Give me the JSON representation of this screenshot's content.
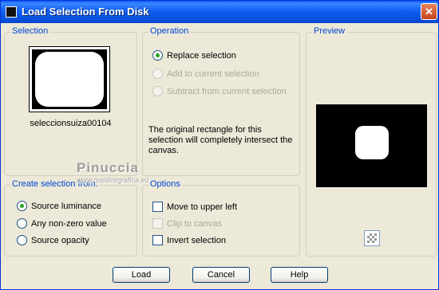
{
  "window": {
    "title": "Load Selection From Disk",
    "close_label": "✕"
  },
  "selection_group": {
    "legend": "Selection",
    "file_name": "seleccionsuiza00104"
  },
  "operation_group": {
    "legend": "Operation",
    "options": [
      {
        "label": "Replace selection",
        "checked": true,
        "enabled": true
      },
      {
        "label": "Add to current selection",
        "checked": false,
        "enabled": false
      },
      {
        "label": "Subtract from current selection",
        "checked": false,
        "enabled": false
      }
    ],
    "info_text": "The original rectangle for this selection will completely intersect the canvas."
  },
  "preview_group": {
    "legend": "Preview"
  },
  "create_group": {
    "legend": "Create selection from:",
    "options": [
      {
        "label": "Source luminance",
        "checked": true
      },
      {
        "label": "Any non-zero value",
        "checked": false
      },
      {
        "label": "Source opacity",
        "checked": false
      }
    ]
  },
  "options_group": {
    "legend": "Options",
    "items": [
      {
        "label": "Move to upper left",
        "checked": false,
        "enabled": true
      },
      {
        "label": "Clip to canvas",
        "checked": false,
        "enabled": false
      },
      {
        "label": "Invert selection",
        "checked": false,
        "enabled": true
      }
    ]
  },
  "watermark": {
    "name": "Pinuccia",
    "url": "www.maidiregrafica.eu"
  },
  "buttons": {
    "load": "Load",
    "cancel": "Cancel",
    "help": "Help"
  },
  "icons": {
    "checker": "transparency-checker-icon"
  },
  "colors": {
    "title_bar": "#0A5BF3",
    "legend_text": "#0046D5",
    "dialog_bg": "#ECE9D8"
  }
}
